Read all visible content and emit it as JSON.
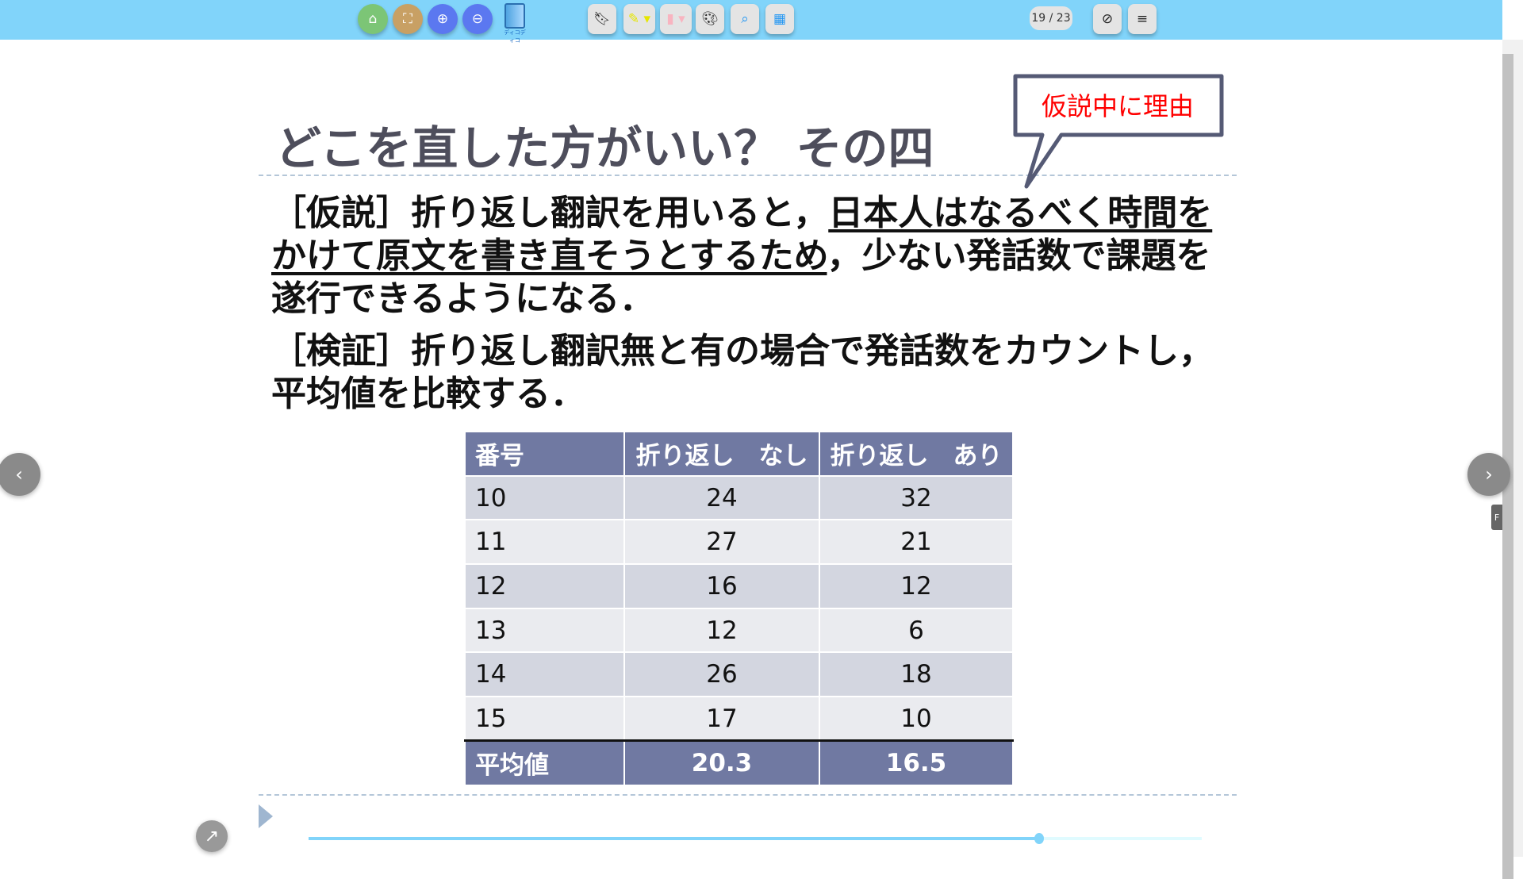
{
  "toolbar": {
    "page_indicator": "19 / 23",
    "logo_text": "ディコディコ",
    "buttons": [
      {
        "name": "home",
        "icon": "home-icon",
        "color": "#7cc576"
      },
      {
        "name": "fullscreen",
        "icon": "fullscreen-icon",
        "color": "#c8a064"
      },
      {
        "name": "zoom-in",
        "icon": "zoom-in-icon",
        "color": "#5b78f0"
      },
      {
        "name": "zoom-out",
        "icon": "zoom-out-icon",
        "color": "#5b78f0"
      }
    ]
  },
  "slide": {
    "title": "どこを直した方がいい？ その四",
    "callout": "仮説中に理由",
    "hypothesis": {
      "pre": "［仮説］折り返し翻訳を用いると，",
      "underlined": "日本人はなるべく時間をかけて原文を書き直そうとするため",
      "post": "，少ない発話数で課題を遂行できるようになる．"
    },
    "verification": "［検証］折り返し翻訳無と有の場合で発話数をカウントし，平均値を比較する．",
    "table": {
      "headers": [
        "番号",
        "折り返し　なし",
        "折り返し　あり"
      ],
      "rows": [
        [
          "10",
          "24",
          "32"
        ],
        [
          "11",
          "27",
          "21"
        ],
        [
          "12",
          "16",
          "12"
        ],
        [
          "13",
          "12",
          "6"
        ],
        [
          "14",
          "26",
          "18"
        ],
        [
          "15",
          "17",
          "10"
        ]
      ],
      "average": [
        "平均値",
        "20.3",
        "16.5"
      ]
    }
  },
  "progress": {
    "current": 19,
    "total": 23,
    "fraction": 0.818
  },
  "side_tab": "F",
  "colors": {
    "toolbar": "#81d4fa",
    "table_header": "#7079a2",
    "callout_text": "#ff0000"
  }
}
